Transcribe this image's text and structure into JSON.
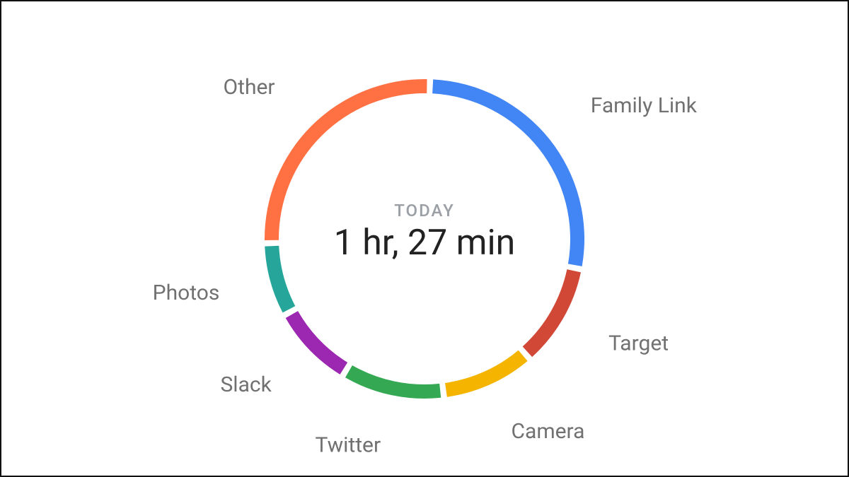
{
  "center": {
    "top_label": "TODAY",
    "main_label": "1 hr, 27 min"
  },
  "chart_data": {
    "type": "pie",
    "title": "TODAY",
    "total_label": "1 hr, 27 min",
    "series": [
      {
        "name": "Family Link",
        "value": 27.5,
        "minutes": 24,
        "color": "#4285f4"
      },
      {
        "name": "Target",
        "value": 10.5,
        "minutes": 9,
        "color": "#d14836"
      },
      {
        "name": "Camera",
        "value": 9.5,
        "minutes": 8,
        "color": "#f4b400"
      },
      {
        "name": "Twitter",
        "value": 10.5,
        "minutes": 9,
        "color": "#34a853"
      },
      {
        "name": "Slack",
        "value": 8.5,
        "minutes": 7,
        "color": "#9c27b0"
      },
      {
        "name": "Photos",
        "value": 7.5,
        "minutes": 7,
        "color": "#26a69a"
      },
      {
        "name": "Other",
        "value": 26.0,
        "minutes": 23,
        "color": "#ff7043"
      }
    ],
    "start_angle_deg": 2,
    "gap_deg": 2.2,
    "ring": {
      "outer_radius": 226,
      "thickness": 20
    },
    "label_radius": 300
  }
}
